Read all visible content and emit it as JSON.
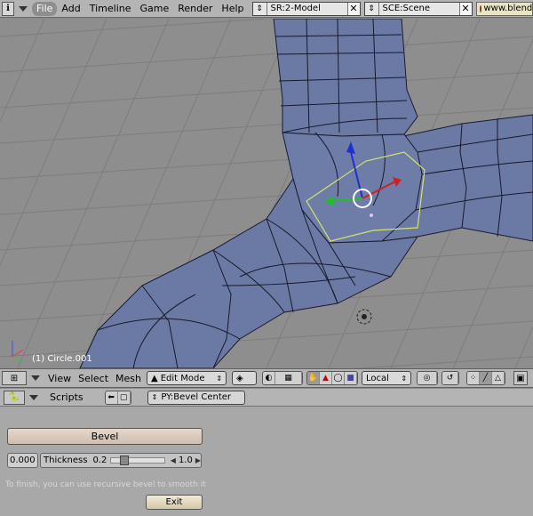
{
  "topbar": {
    "menus": [
      "File",
      "Add",
      "Timeline",
      "Game",
      "Render",
      "Help"
    ],
    "screen": {
      "prefix": "SR:2",
      "label": "SR:2-Model"
    },
    "scene": {
      "prefix": "SCE:",
      "label": "SCE:Scene"
    },
    "url": "www.blender"
  },
  "viewport": {
    "object_label": "(1) Circle.001",
    "colors": {
      "background": "#8e8e8e",
      "grid": "#7c7c7c",
      "mesh_fill": "#6878a0",
      "edge": "#1a1a30",
      "selected_edge": "#d8e070"
    }
  },
  "view3d_header": {
    "menus": [
      "View",
      "Select",
      "Mesh"
    ],
    "mode": "Edit Mode",
    "orientation": "Local"
  },
  "scripts": {
    "header_label": "Scripts",
    "script_name": "PY:Bevel Center",
    "bevel_label": "Bevel",
    "num_value": "0.000",
    "thickness_label": "Thickness",
    "thickness_value": "0.2",
    "thickness_max": "1.0",
    "thickness_fraction": 0.2,
    "hint": "To finish, you can use recursive bevel to smooth it",
    "exit_label": "Exit"
  }
}
